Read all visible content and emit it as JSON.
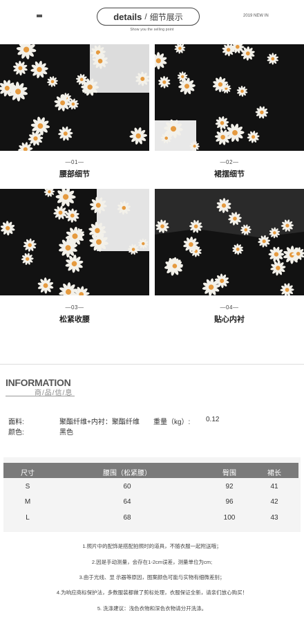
{
  "header": {
    "title_en": "details",
    "separator": "/",
    "title_cn": "细节展示",
    "subtitle": "Show you the selling point",
    "tag": "2019 NEW IN"
  },
  "details": [
    {
      "num": "—01—",
      "title": "腰部细节"
    },
    {
      "num": "—02—",
      "title": "裙摆细节"
    },
    {
      "num": "—03—",
      "title": "松紧收腰"
    },
    {
      "num": "—04—",
      "title": "贴心内衬"
    }
  ],
  "information": {
    "title": "INFORMATION",
    "subtitle": "商/品/信/息",
    "material_label": "面料:",
    "material_value": "聚酯纤维+内衬：聚酯纤维",
    "weight_label": "重量（kg）:",
    "weight_value": "0.12",
    "color_label": "颜色:",
    "color_value": "黑色"
  },
  "size_table": {
    "headers": [
      "尺寸",
      "腰围（松紧腰）",
      "臀围",
      "裙长"
    ],
    "rows": [
      [
        "S",
        "60",
        "92",
        "41"
      ],
      [
        "M",
        "64",
        "96",
        "42"
      ],
      [
        "L",
        "68",
        "100",
        "43"
      ]
    ]
  },
  "notes": [
    "1.照片中的配饰是搭配拍照时的道具，不随衣服一起附送哦；",
    "2.因是手动测量，会存在1-2cm误差，测量单位为cm;",
    "3.由于光线、显 示器等原因，图案颜色可能与实物有细微差别；",
    "4.为响应商标保护法，多数服装都做了剪标处理，衣服保证全新，请亲们放心购买！",
    "5. 洗涤建议：浅色衣物和深色衣物请分开洗涤。"
  ],
  "colors": {
    "fabric": "#121212",
    "petal": "#f3f1ea",
    "flower_center": "#e59a3f",
    "table_header": "#7a7a7a"
  },
  "icons": [
    "menu-icon",
    "daisy-pattern"
  ]
}
